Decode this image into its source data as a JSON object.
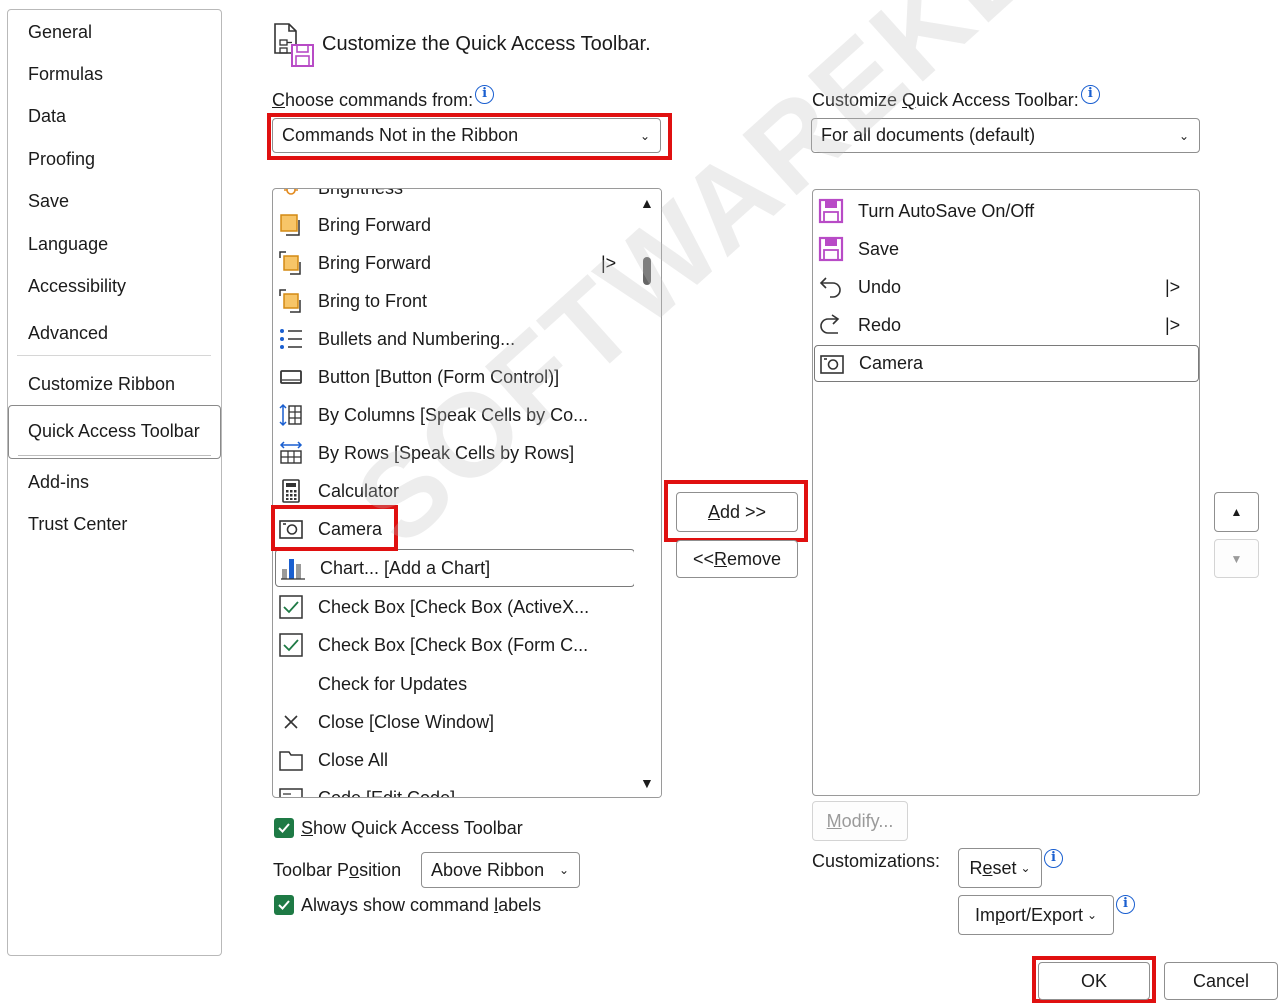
{
  "nav": {
    "items": [
      "General",
      "Formulas",
      "Data",
      "Proofing",
      "Save",
      "Language",
      "Accessibility",
      "Advanced",
      "Customize Ribbon",
      "Quick Access Toolbar",
      "Add-ins",
      "Trust Center"
    ],
    "selected": "Quick Access Toolbar"
  },
  "header": {
    "title": "Customize the Quick Access Toolbar."
  },
  "left": {
    "choose_label_first": "C",
    "choose_label_rest": "hoose commands from:",
    "choose_value": "Commands Not in the Ribbon",
    "partial_top": "Brightness",
    "items": [
      {
        "label": "Bring Forward",
        "icon": "bring-forward-icon"
      },
      {
        "label": "Bring Forward",
        "icon": "bring-forward-menu-icon",
        "submenu": "|>"
      },
      {
        "label": "Bring to Front",
        "icon": "bring-to-front-icon"
      },
      {
        "label": "Bullets and Numbering...",
        "icon": "bullets-icon"
      },
      {
        "label": "Button [Button (Form Control)]",
        "icon": "button-control-icon"
      },
      {
        "label": "By Columns [Speak Cells by Co...",
        "icon": "by-columns-icon"
      },
      {
        "label": "By Rows [Speak Cells by Rows]",
        "icon": "by-rows-icon"
      },
      {
        "label": "Calculator",
        "icon": "calculator-icon"
      },
      {
        "label": "Camera",
        "icon": "camera-icon"
      },
      {
        "label": "Chart... [Add a Chart]",
        "icon": "chart-icon"
      },
      {
        "label": "Check Box [Check Box (ActiveX...",
        "icon": "checkbox-icon"
      },
      {
        "label": "Check Box [Check Box (Form C...",
        "icon": "checkbox-icon"
      },
      {
        "label": "Check for Updates",
        "icon": ""
      },
      {
        "label": "Close [Close Window]",
        "icon": "close-icon"
      },
      {
        "label": "Close All",
        "icon": "close-all-icon"
      }
    ],
    "partial_bottom": "Code [Edit Code]"
  },
  "right": {
    "label_pre": "Customize ",
    "label_u": "Q",
    "label_post": "uick Access Toolbar:",
    "scope_value": "For all documents (default)",
    "items": [
      {
        "label": "Turn AutoSave On/Off",
        "icon": "autosave-icon"
      },
      {
        "label": "Save",
        "icon": "save-icon"
      },
      {
        "label": "Undo",
        "icon": "undo-icon",
        "submenu": "|>"
      },
      {
        "label": "Redo",
        "icon": "redo-icon",
        "submenu": "|>"
      },
      {
        "label": "Camera",
        "icon": "camera-icon"
      }
    ]
  },
  "buttons": {
    "add_u": "A",
    "add_rest": "dd >>",
    "remove_pre": "<< ",
    "remove_u": "R",
    "remove_rest": "emove",
    "modify_u": "M",
    "modify_rest": "odify...",
    "reset_pre": "R",
    "reset_u": "e",
    "reset_rest": "set",
    "import_pre": "Im",
    "import_u": "p",
    "import_rest": "ort/Export",
    "ok": "OK",
    "cancel": "Cancel"
  },
  "options": {
    "show_qat_u": "S",
    "show_qat_rest": "how Quick Access Toolbar",
    "toolbar_position_pre": "Toolbar P",
    "toolbar_position_u": "o",
    "toolbar_position_rest": "sition",
    "toolbar_position_value": "Above Ribbon",
    "always_labels_pre": "Always show command ",
    "always_labels_u": "l",
    "always_labels_rest": "abels",
    "customizations_label": "Customizations:"
  },
  "watermark": "SOFTWAREKEEP.COM",
  "colors": {
    "accent": "#1a5fd0",
    "highlight": "#e01010",
    "check": "#1e7a45"
  }
}
